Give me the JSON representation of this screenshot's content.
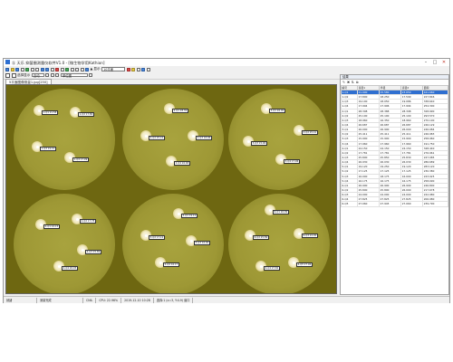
{
  "window": {
    "title": "Ⓢ 天乐 抑菌圈测量仪软件V1.0 - [微生物学用Kathion]",
    "minimize": "–",
    "maximize": "□",
    "close": "✕"
  },
  "toolbar": {
    "zoom_label": "▲ 显示",
    "zoom_value": "10平面",
    "mode_label": "自动",
    "checkbox1_label": "",
    "checkbox2_label": "选择显示",
    "unit_label": "mm",
    "dropdown_value": "单位图"
  },
  "tab": {
    "label": "5平面图像测量1.jpg[250]"
  },
  "panel": {
    "title": "结果",
    "columns": [
      "编号",
      "直径1",
      "半径",
      "直径2",
      "面积"
    ],
    "rows": [
      [
        "1-Q1",
        "21.990",
        "15.580",
        "23.650",
        "441.660"
      ],
      [
        "1-Q2",
        "17.800",
        "18.250",
        "17.599",
        "227.846"
      ],
      [
        "1-Q3",
        "19.100",
        "18.050",
        "19.086",
        "338.640"
      ],
      [
        "1-Q4",
        "17.994",
        "17.996",
        "17.994",
        "254.300"
      ],
      [
        "2-Q1",
        "28.398",
        "28.388",
        "28.398",
        "328.990"
      ],
      [
        "2-Q2",
        "25.100",
        "25.100",
        "25.100",
        "293.570"
      ],
      [
        "2-Q3",
        "18.960",
        "16.350",
        "18.960",
        "270.100"
      ],
      [
        "2-Q4",
        "26.687",
        "26.687",
        "26.687",
        "246.129"
      ],
      [
        "3-Q1",
        "26.000",
        "26.990",
        "26.000",
        "246.084"
      ],
      [
        "3-Q2",
        "25.411",
        "25.411",
        "25.411",
        "246.983"
      ],
      [
        "3-Q3",
        "15.900",
        "15.900",
        "15.900",
        "258.960"
      ],
      [
        "3-Q4",
        "17.960",
        "17.960",
        "17.960",
        "191.750"
      ],
      [
        "4-Q1",
        "24.150",
        "24.150",
        "24.150",
        "348.440"
      ],
      [
        "4-Q2",
        "17.781",
        "17.781",
        "17.781",
        "276.961"
      ],
      [
        "4-Q3",
        "25.890",
        "25.850",
        "25.830",
        "247.085"
      ],
      [
        "4-Q4",
        "26.930",
        "26.030",
        "26.030",
        "286.689"
      ],
      [
        "5-Q1",
        "19.120",
        "19.250",
        "19.120",
        "283.120"
      ],
      [
        "5-Q2",
        "17.125",
        "17.125",
        "17.125",
        "230.380"
      ],
      [
        "5-Q3",
        "16.000",
        "18.175",
        "16.000",
        "243.025"
      ],
      [
        "5-Q4",
        "16.175",
        "16.175",
        "16.175",
        "258.090"
      ],
      [
        "6-Q1",
        "26.990",
        "26.990",
        "26.990",
        "246.800"
      ],
      [
        "6-Q2",
        "25.890",
        "25.890",
        "26.000",
        "217.678"
      ],
      [
        "6-Q3",
        "24.000",
        "24.000",
        "24.000",
        "242.980"
      ],
      [
        "6-Q4",
        "27.825",
        "27.825",
        "27.825",
        "206.980"
      ],
      [
        "6-Q5",
        "27.060",
        "27.945",
        "27.060",
        "239.790"
      ]
    ]
  },
  "statusbar": {
    "ready": "就绪",
    "cells": [
      "测量完成",
      "CNIL",
      "CPU: 22.96%",
      "2019-12-10 10:28",
      "选择:1 (x=3, Y:4.9) 窗口"
    ]
  },
  "dishes": [
    {
      "zones": [
        {
          "label": "1-Q1 21.58"
        },
        {
          "label": "1-Q2 17.80"
        },
        {
          "label": "1-Q3 19.10"
        },
        {
          "label": "1-Q4 17.99"
        }
      ]
    },
    {
      "zones": [
        {
          "label": "2-Q1 28.39"
        },
        {
          "label": "2-Q2 25.10"
        },
        {
          "label": "2-Q3 18.96"
        },
        {
          "label": "2-Q4 26.68"
        }
      ]
    },
    {
      "zones": [
        {
          "label": "3-Q1 26.00"
        },
        {
          "label": "3-Q2 25.41"
        },
        {
          "label": "3-Q3 15.90"
        },
        {
          "label": "3-Q4 17.96"
        }
      ]
    },
    {
      "zones": [
        {
          "label": "4-Q1 24.15"
        },
        {
          "label": "4-Q2 17.78"
        },
        {
          "label": "4-Q3 25.89"
        },
        {
          "label": "4-Q4 26.93"
        }
      ]
    },
    {
      "zones": [
        {
          "label": "5-Q1 19.12"
        },
        {
          "label": "5-Q2 17.12"
        },
        {
          "label": "5-Q3 16.00"
        },
        {
          "label": "5-Q4 16.17"
        }
      ]
    },
    {
      "zones": [
        {
          "label": "6-Q1 26.99"
        },
        {
          "label": "6-Q2 25.89"
        },
        {
          "label": "6-Q3 24.00"
        },
        {
          "label": "6-Q4 27.82"
        },
        {
          "label": "6-Q5 27.06"
        }
      ]
    }
  ]
}
